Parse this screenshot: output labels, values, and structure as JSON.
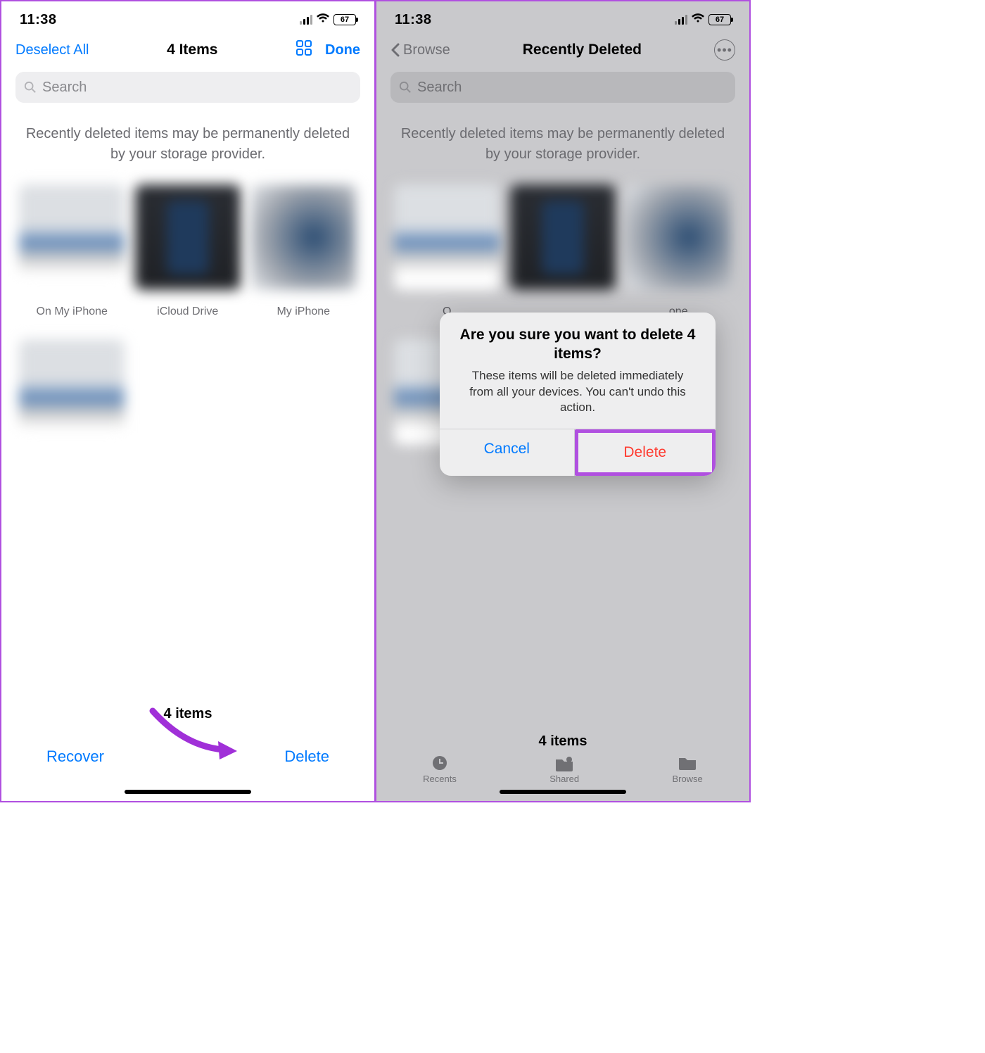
{
  "left": {
    "status": {
      "time": "11:38",
      "battery": "67"
    },
    "nav": {
      "deselect": "Deselect All",
      "title": "4 Items",
      "done": "Done"
    },
    "search_placeholder": "Search",
    "notice": "Recently deleted items may be permanently deleted by your storage provider.",
    "items": [
      {
        "caption": "On My iPhone"
      },
      {
        "caption": "iCloud Drive"
      },
      {
        "caption": "My iPhone"
      },
      {
        "caption": ""
      }
    ],
    "footer_count": "4 items",
    "recover": "Recover",
    "delete": "Delete"
  },
  "right": {
    "status": {
      "time": "11:38",
      "battery": "67"
    },
    "nav": {
      "back": "Browse",
      "title": "Recently Deleted"
    },
    "search_placeholder": "Search",
    "notice": "Recently deleted items may be permanently deleted by your storage provider.",
    "items": [
      {
        "caption": "O"
      },
      {
        "caption": ""
      },
      {
        "caption": "one"
      },
      {
        "caption": ""
      }
    ],
    "footer_count": "4 items",
    "tabs": {
      "recents": "Recents",
      "shared": "Shared",
      "browse": "Browse"
    },
    "dialog": {
      "title": "Are you sure you want to delete 4 items?",
      "message": "These items will be deleted immediately from all your devices. You can't undo this action.",
      "cancel": "Cancel",
      "delete": "Delete"
    }
  }
}
